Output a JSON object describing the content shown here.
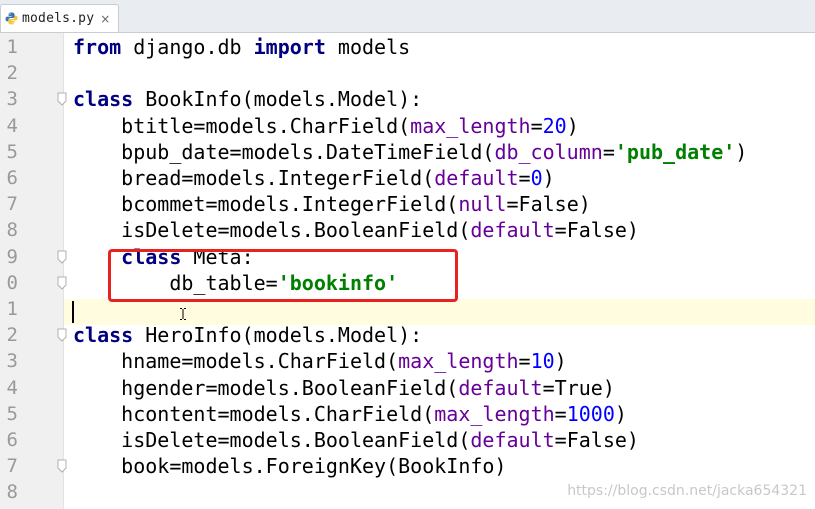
{
  "tab": {
    "filename": "models.py",
    "close_glyph": "×",
    "icon": "python-file-icon"
  },
  "editor": {
    "line_numbers": [
      "1",
      "2",
      "3",
      "4",
      "5",
      "6",
      "7",
      "8",
      "9",
      "0",
      "1",
      "2",
      "3",
      "4",
      "5",
      "6",
      "7",
      "8"
    ],
    "lines": [
      [
        {
          "t": "from",
          "c": "kw"
        },
        {
          "t": " django.db "
        },
        {
          "t": "import",
          "c": "kw"
        },
        {
          "t": " models"
        }
      ],
      [],
      [
        {
          "t": "class",
          "c": "kw"
        },
        {
          "t": " BookInfo(models.Model):"
        }
      ],
      [
        {
          "t": "    btitle=models.CharField("
        },
        {
          "t": "max_length",
          "c": "param"
        },
        {
          "t": "="
        },
        {
          "t": "20",
          "c": "num"
        },
        {
          "t": ")"
        }
      ],
      [
        {
          "t": "    bpub_date=models.DateTimeField("
        },
        {
          "t": "db_column",
          "c": "param"
        },
        {
          "t": "="
        },
        {
          "t": "'pub_date'",
          "c": "str"
        },
        {
          "t": ")"
        }
      ],
      [
        {
          "t": "    bread=models.IntegerField("
        },
        {
          "t": "default",
          "c": "param"
        },
        {
          "t": "="
        },
        {
          "t": "0",
          "c": "num"
        },
        {
          "t": ")"
        }
      ],
      [
        {
          "t": "    bcommet=models.IntegerField("
        },
        {
          "t": "null",
          "c": "param"
        },
        {
          "t": "=False)"
        }
      ],
      [
        {
          "t": "    isDelete=models.BooleanField("
        },
        {
          "t": "default",
          "c": "param"
        },
        {
          "t": "=False)"
        }
      ],
      [
        {
          "t": "    "
        },
        {
          "t": "class",
          "c": "kw"
        },
        {
          "t": " Meta:"
        }
      ],
      [
        {
          "t": "        db_table="
        },
        {
          "t": "'bookinfo'",
          "c": "str"
        }
      ],
      [],
      [
        {
          "t": "class",
          "c": "kw"
        },
        {
          "t": " HeroInfo(models.Model):"
        }
      ],
      [
        {
          "t": "    hname=models.CharField("
        },
        {
          "t": "max_length",
          "c": "param"
        },
        {
          "t": "="
        },
        {
          "t": "10",
          "c": "num"
        },
        {
          "t": ")"
        }
      ],
      [
        {
          "t": "    hgender=models.BooleanField("
        },
        {
          "t": "default",
          "c": "param"
        },
        {
          "t": "=True)"
        }
      ],
      [
        {
          "t": "    hcontent=models.CharField("
        },
        {
          "t": "max_length",
          "c": "param"
        },
        {
          "t": "="
        },
        {
          "t": "1000",
          "c": "num"
        },
        {
          "t": ")"
        }
      ],
      [
        {
          "t": "    isDelete=models.BooleanField("
        },
        {
          "t": "default",
          "c": "param"
        },
        {
          "t": "=False)"
        }
      ],
      [
        {
          "t": "    book=models.ForeignKey(BookInfo)"
        }
      ],
      []
    ],
    "fold_marker_lines": [
      3,
      9,
      10,
      12,
      17
    ],
    "caret_line": 11
  },
  "watermark": "https://blog.csdn.net/jacka654321",
  "colors": {
    "keyword": "#000080",
    "string": "#008000",
    "number": "#0000ff",
    "parameter": "#660099",
    "highlight_box": "#e8231f",
    "caret_line_bg": "#fffce0"
  }
}
